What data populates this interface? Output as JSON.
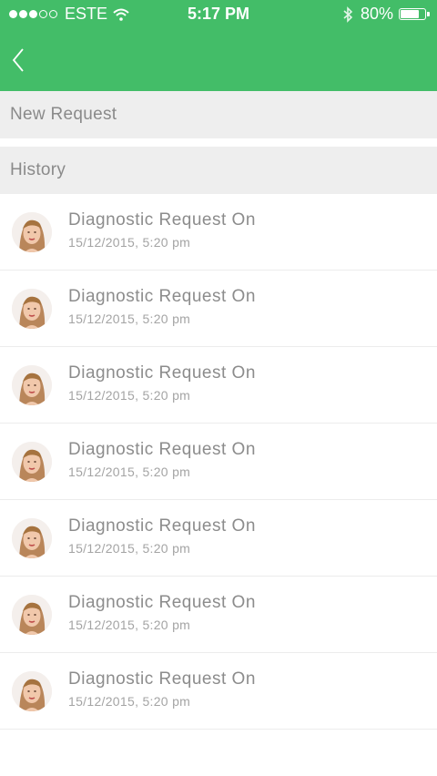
{
  "status_bar": {
    "carrier": "ESTE",
    "time": "5:17 PM",
    "battery_text": "80%",
    "battery_level": 0.8
  },
  "colors": {
    "accent": "#43bd68",
    "section_bg": "#eeeeee"
  },
  "nav": {
    "back_icon": "chevron-left-icon"
  },
  "sections": {
    "new_request": "New Request",
    "history": "History"
  },
  "history": [
    {
      "title": "Diagnostic Request On",
      "datetime": "15/12/2015,  5:20 pm",
      "avatar_icon": "avatar"
    },
    {
      "title": "Diagnostic Request On",
      "datetime": "15/12/2015,  5:20 pm",
      "avatar_icon": "avatar"
    },
    {
      "title": "Diagnostic Request On",
      "datetime": "15/12/2015,  5:20 pm",
      "avatar_icon": "avatar"
    },
    {
      "title": "Diagnostic Request On",
      "datetime": "15/12/2015,  5:20 pm",
      "avatar_icon": "avatar"
    },
    {
      "title": "Diagnostic Request On",
      "datetime": "15/12/2015,  5:20 pm",
      "avatar_icon": "avatar"
    },
    {
      "title": "Diagnostic Request On",
      "datetime": "15/12/2015,  5:20 pm",
      "avatar_icon": "avatar"
    },
    {
      "title": "Diagnostic Request On",
      "datetime": "15/12/2015,  5:20 pm",
      "avatar_icon": "avatar"
    }
  ]
}
